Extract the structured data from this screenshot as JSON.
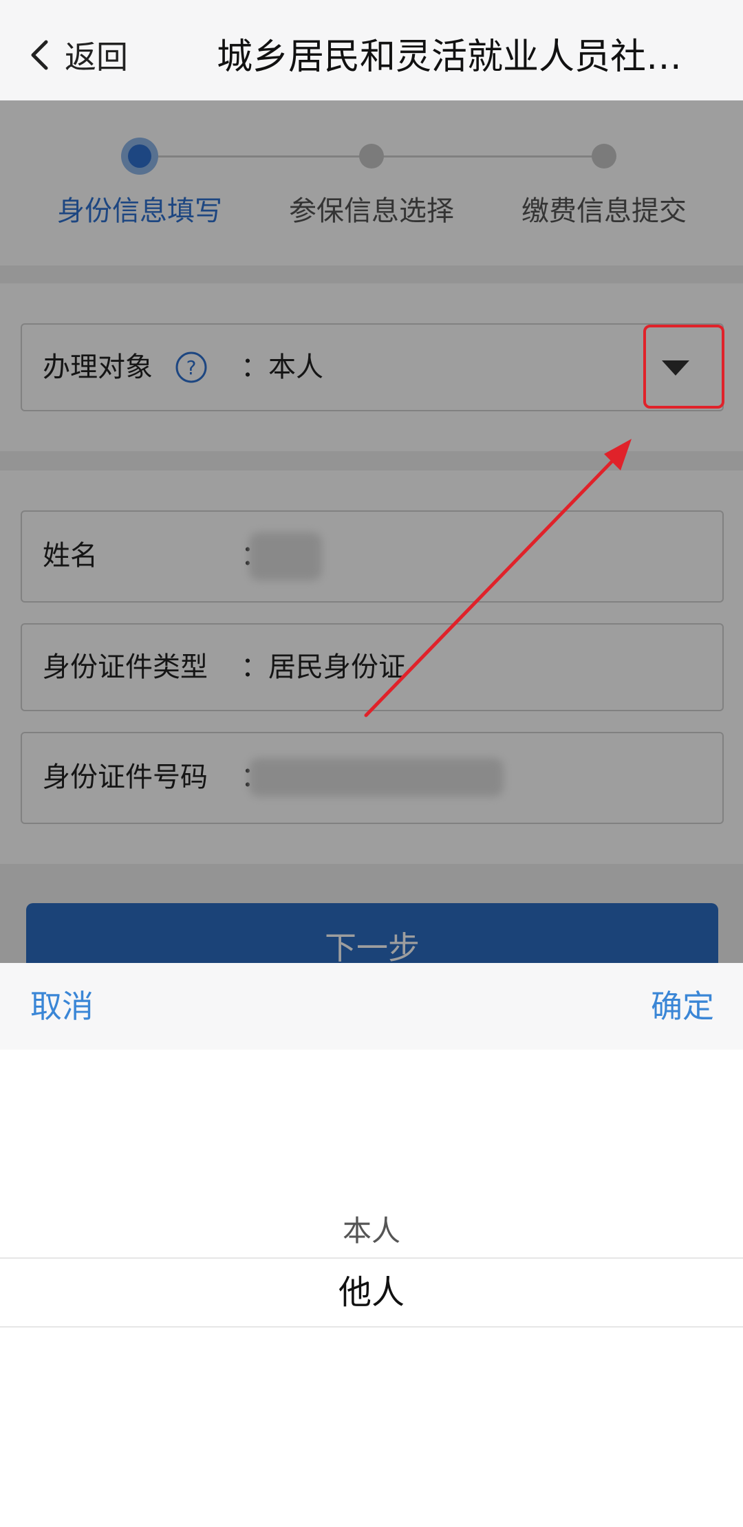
{
  "navbar": {
    "back_label": "返回",
    "title": "城乡居民和灵活就业人员社保..."
  },
  "stepper": {
    "steps": [
      {
        "label": "身份信息填写",
        "active": true
      },
      {
        "label": "参保信息选择",
        "active": false
      },
      {
        "label": "缴费信息提交",
        "active": false
      }
    ]
  },
  "form": {
    "handling_target": {
      "label": "办理对象",
      "value": "本人"
    },
    "name": {
      "label": "姓名",
      "value": ""
    },
    "id_type": {
      "label": "身份证件类型",
      "value": "居民身份证"
    },
    "id_number": {
      "label": "身份证件号码",
      "value": ""
    },
    "colon": "："
  },
  "next_button": {
    "label": "下一步"
  },
  "picker": {
    "cancel_label": "取消",
    "confirm_label": "确定",
    "options": [
      "本人",
      "他人"
    ]
  },
  "colors": {
    "primary_blue": "#2f72d0",
    "button_blue": "#2d6dc2",
    "picker_action_blue": "#3a86d6",
    "annotation_red": "#e0222a"
  },
  "icons": [
    "chevron-left-icon",
    "help-circle-icon",
    "caret-down-icon"
  ]
}
